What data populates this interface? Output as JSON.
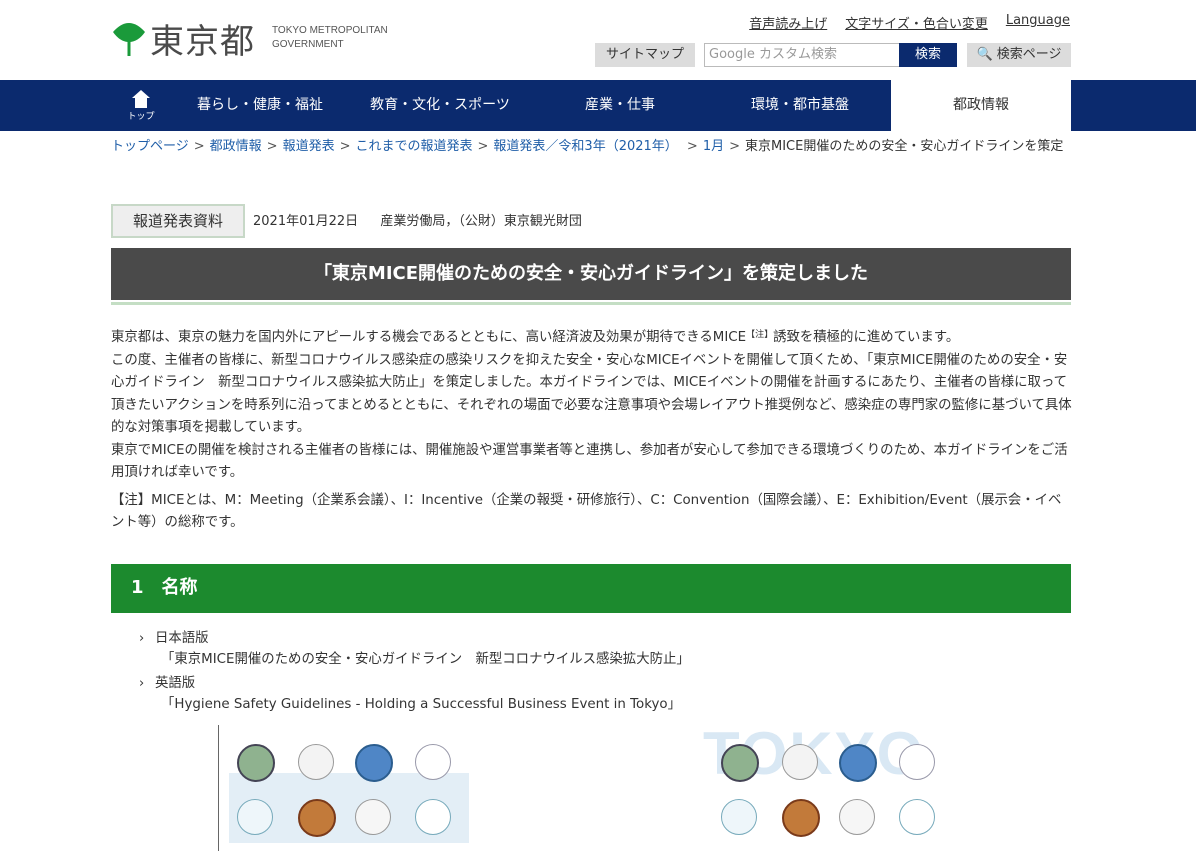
{
  "header": {
    "logo_jp": "東京都",
    "logo_en_line1": "TOKYO METROPOLITAN",
    "logo_en_line2": "GOVERNMENT",
    "util_links": [
      "音声読み上げ",
      "文字サイズ・色合い変更",
      "Language"
    ],
    "sitemap_label": "サイトマップ",
    "search_placeholder": "Google カスタム検索",
    "search_button": "検索",
    "search_page_button": "検索ページ"
  },
  "nav": {
    "home_label": "トップ",
    "items": [
      "暮らし・健康・福祉",
      "教育・文化・スポーツ",
      "産業・仕事",
      "環境・都市基盤",
      "都政情報"
    ]
  },
  "breadcrumb": {
    "links": [
      "トップページ",
      "都政情報",
      "報道発表",
      "これまでの報道発表",
      "報道発表／令和3年（2021年）",
      "1月"
    ],
    "current": "東京MICE開催のための安全・安心ガイドラインを策定"
  },
  "press": {
    "badge": "報道発表資料",
    "date": "2021年01月22日",
    "source": "産業労働局，（公財）東京観光財団"
  },
  "title": "「東京MICE開催のための安全・安心ガイドライン」を策定しました",
  "body": {
    "p1_a": "東京都は、東京の魅力を国内外にアピールする機会であるとともに、高い経済波及効果が期待できるMICE",
    "p1_sup": "【注】",
    "p1_b": "誘致を積極的に進めています。",
    "p2": "この度、主催者の皆様に、新型コロナウイルス感染症の感染リスクを抑えた安全・安心なMICEイベントを開催して頂くため、「東京MICE開催のための安全・安心ガイドライン　新型コロナウイルス感染拡大防止」を策定しました。本ガイドラインでは、MICEイベントの開催を計画するにあたり、主催者の皆様に取って頂きたいアクションを時系列に沿ってまとめるとともに、それぞれの場面で必要な注意事項や会場レイアウト推奨例など、感染症の専門家の監修に基づいて具体的な対策事項を掲載しています。",
    "p3": "東京でMICEの開催を検討される主催者の皆様には、開催施設や運営事業者等と連携し、参加者が安心して参加できる環境づくりのため、本ガイドラインをご活用頂ければ幸いです。",
    "note": "【注】MICEとは、M：Meeting（企業系会議）、I：Incentive（企業の報奨・研修旅行）、C：Convention（国際会議）、E：Exhibition/Event（展示会・イベント等）の総称です。"
  },
  "section1": {
    "heading": "1　名称",
    "items": [
      {
        "label": "日本語版",
        "link": "「東京MICE開催のための安全・安心ガイドライン　新型コロナウイルス感染拡大防止」"
      },
      {
        "label": "英語版",
        "link": "「Hygiene Safety Guidelines - Holding a Successful Business Event in Tokyo」"
      }
    ]
  },
  "thumbs": {
    "en_watermark": "TOKYO"
  },
  "colors": {
    "nav_bg": "#0b2a6e",
    "section_green": "#1c8a2e",
    "title_bg": "#4a4a4a"
  }
}
